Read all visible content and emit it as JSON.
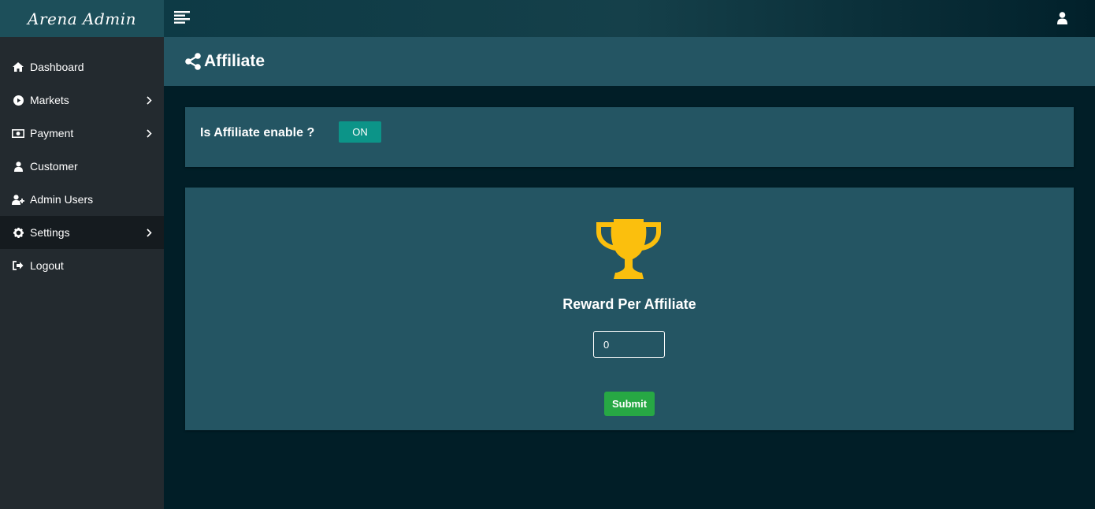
{
  "brand": {
    "name": "Arena Admin"
  },
  "sidebar": {
    "items": [
      {
        "label": "Dashboard",
        "icon": "home-icon",
        "has_submenu": false,
        "active": false
      },
      {
        "label": "Markets",
        "icon": "play-circle-icon",
        "has_submenu": true,
        "active": false
      },
      {
        "label": "Payment",
        "icon": "money-icon",
        "has_submenu": true,
        "active": false
      },
      {
        "label": "Customer",
        "icon": "user-icon",
        "has_submenu": false,
        "active": false
      },
      {
        "label": "Admin Users",
        "icon": "user-plus-icon",
        "has_submenu": false,
        "active": false
      },
      {
        "label": "Settings",
        "icon": "gear-icon",
        "has_submenu": true,
        "active": true
      },
      {
        "label": "Logout",
        "icon": "sign-out-icon",
        "has_submenu": false,
        "active": false
      }
    ]
  },
  "topbar": {
    "menu_icon": "menu-toggle-icon",
    "user_icon": "user-icon"
  },
  "page": {
    "title": "Affiliate",
    "title_icon": "share-icon"
  },
  "affiliate_toggle": {
    "label": "Is Affiliate enable ?",
    "state": "ON"
  },
  "reward": {
    "icon": "trophy-icon",
    "title": "Reward Per Affiliate",
    "value": "0",
    "submit_label": "Submit"
  },
  "colors": {
    "sidebar_bg": "#232a2f",
    "brand_bg": "#1d4f5a",
    "content_bg": "#011e27",
    "card_bg": "#245563",
    "toggle_on": "#0c9488",
    "submit": "#27a844",
    "trophy": "#fbbf0d"
  }
}
